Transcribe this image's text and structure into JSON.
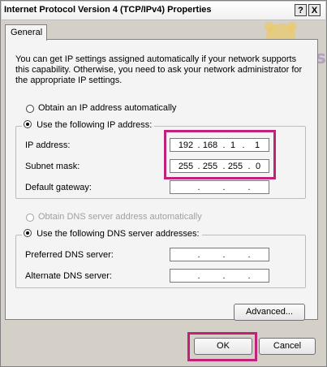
{
  "window": {
    "title": "Internet Protocol Version 4 (TCP/IPv4) Properties",
    "help_label": "?",
    "close_label": "X"
  },
  "tab": {
    "label": "General"
  },
  "description": "You can get IP settings assigned automatically if your network supports this capability. Otherwise, you need to ask your network administrator for the appropriate IP settings.",
  "ip": {
    "auto_label": "Obtain an IP address automatically",
    "manual_label": "Use the following IP address:",
    "address_label": "IP address:",
    "address": [
      "192",
      "168",
      "1",
      "1"
    ],
    "subnet_label": "Subnet mask:",
    "subnet": [
      "255",
      "255",
      "255",
      "0"
    ],
    "gateway_label": "Default gateway:",
    "gateway": [
      "",
      "",
      "",
      ""
    ]
  },
  "dns": {
    "auto_label": "Obtain DNS server address automatically",
    "manual_label": "Use the following DNS server addresses:",
    "preferred_label": "Preferred DNS server:",
    "preferred": [
      "",
      "",
      "",
      ""
    ],
    "alternate_label": "Alternate DNS server:",
    "alternate": [
      "",
      "",
      "",
      ""
    ]
  },
  "buttons": {
    "advanced": "Advanced...",
    "ok": "OK",
    "cancel": "Cancel"
  },
  "watermark": {
    "text": "Tiwsh"
  },
  "colors": {
    "highlight": "#c0227a",
    "dialog_bg": "#d4d0c8",
    "panel_bg": "#f4f4f4"
  }
}
